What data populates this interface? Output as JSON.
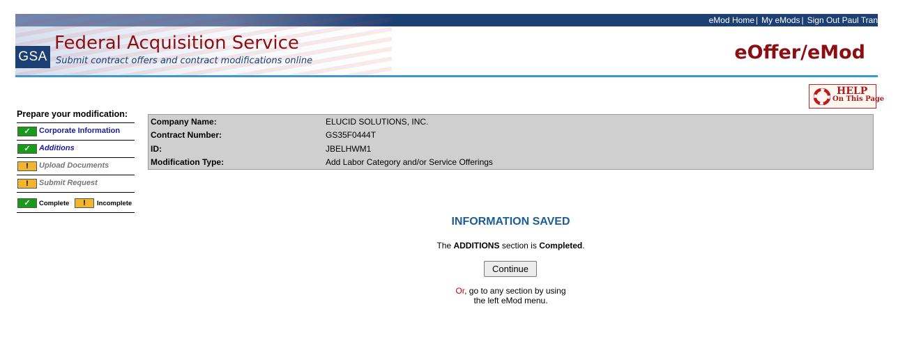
{
  "header": {
    "top_links": [
      "eMod Home",
      "My eMods",
      "Sign Out Paul Tran"
    ],
    "logo": "GSA",
    "agency_title": "Federal Acquisition Service",
    "agency_subtitle": "Submit contract offers and contract modifications online",
    "app_title": "eOffer/eMod",
    "help_label_big": "HELP",
    "help_label_small": "On This Page"
  },
  "sidebar": {
    "heading": "Prepare your modification:",
    "items": [
      {
        "label": "Corporate Information",
        "status": "complete",
        "icon": "check-icon"
      },
      {
        "label": "Additions",
        "status": "complete",
        "icon": "check-icon"
      },
      {
        "label": "Upload Documents",
        "status": "incomplete",
        "icon": "exclamation-icon"
      },
      {
        "label": "Submit Request",
        "status": "incomplete",
        "icon": "exclamation-icon"
      }
    ],
    "legend": {
      "complete": "Complete",
      "incomplete": "Incomplete"
    }
  },
  "info": {
    "rows": [
      {
        "label": "Company Name:",
        "value": "ELUCID SOLUTIONS, INC."
      },
      {
        "label": "Contract Number:",
        "value": "GS35F0444T"
      },
      {
        "label": "ID:",
        "value": "JBELHWM1"
      },
      {
        "label": "Modification Type:",
        "value": "Add Labor Category and/or Service Offerings"
      }
    ]
  },
  "main": {
    "title": "INFORMATION SAVED",
    "msg_prefix": "The",
    "msg_section": "ADDITIONS",
    "msg_middle": "section is",
    "msg_status": "Completed",
    "msg_end": ".",
    "continue_label": "Continue",
    "or_word": "Or",
    "or_rest_line1": ", go to any section by using",
    "or_line2": "the left eMod menu."
  },
  "colors": {
    "navy": "#1c3f74",
    "maroon": "#8b0f12",
    "accent_blue": "#3a9ad0",
    "complete_green": "#1a9a1a",
    "incomplete_amber": "#f2b530",
    "info_bg": "#cfcfcf"
  }
}
